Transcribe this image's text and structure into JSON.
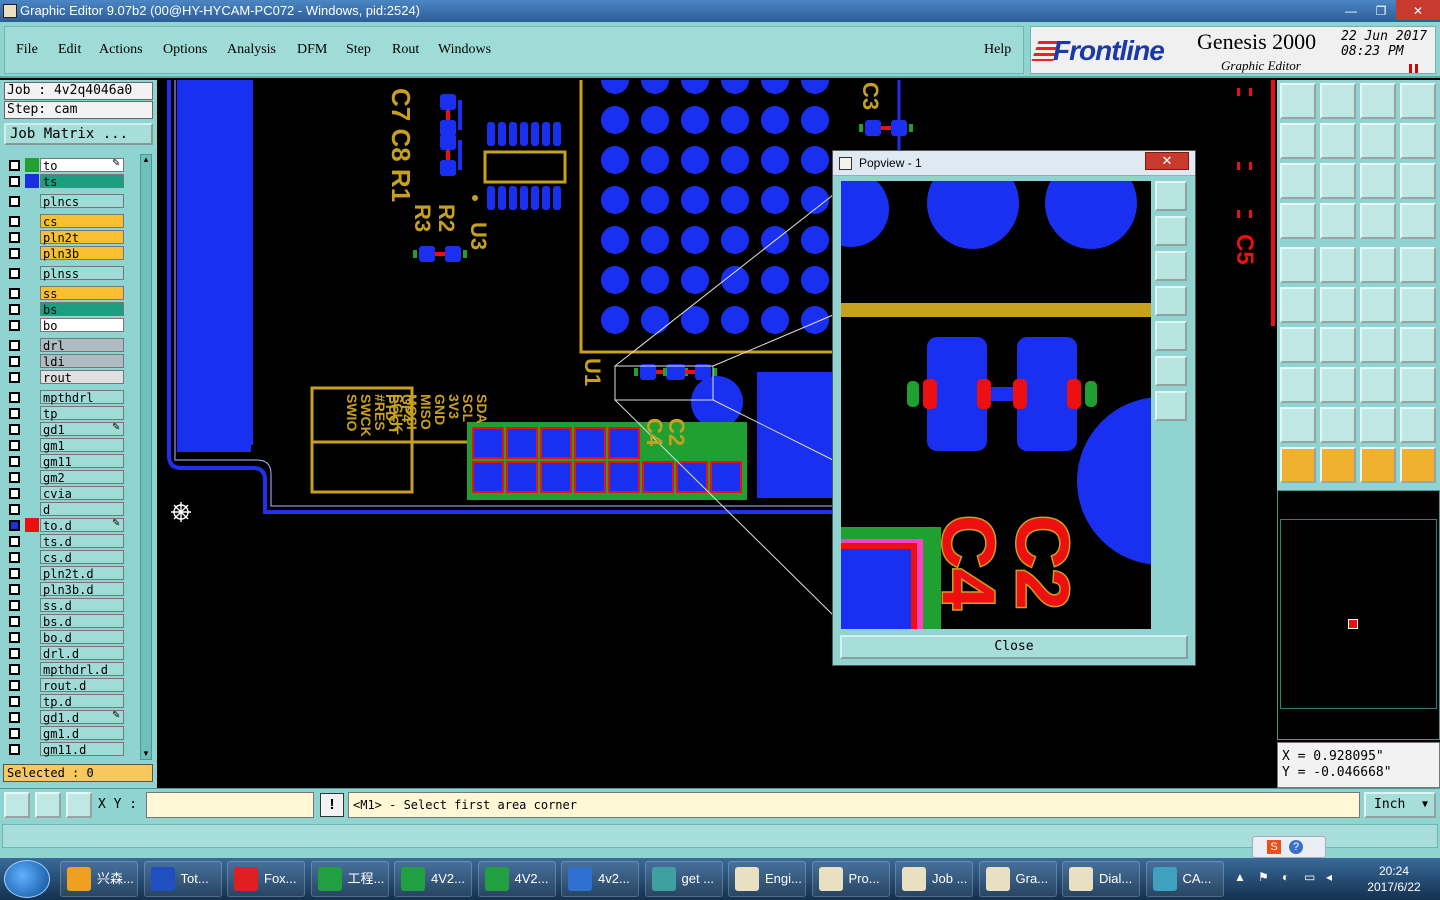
{
  "window": {
    "title": "Graphic Editor 9.07b2 (00@HY-HYCAM-PC072 - Windows, pid:2524)",
    "controls": [
      "—",
      "❐",
      "✕"
    ]
  },
  "menu": [
    "File",
    "Edit",
    "Actions",
    "Options",
    "Analysis",
    "DFM",
    "Step",
    "Rout",
    "Windows"
  ],
  "help_label": "Help",
  "brand": {
    "logo": "Frontline",
    "product": "Genesis 2000",
    "subtitle": "Graphic Editor",
    "date": "22  Jun  2017",
    "time": "08:23  PM"
  },
  "job": {
    "job_line": "Job : 4v2q4046a0",
    "step_line": "Step: cam",
    "matrix_button": "Job Matrix ..."
  },
  "layers": [
    {
      "name": "to",
      "color": "#ffffff",
      "swatch": "#22a030",
      "edge": true
    },
    {
      "name": "ts",
      "color": "#1aa080",
      "swatch": "#1a30e0"
    },
    {
      "name": "plncs",
      "color": "#9fdcd7",
      "swatch": ""
    },
    {
      "name": "cs",
      "color": "#f8c030",
      "swatch": ""
    },
    {
      "name": "pln2t",
      "color": "#f8c030",
      "swatch": ""
    },
    {
      "name": "pln3b",
      "color": "#f8c030",
      "swatch": ""
    },
    {
      "name": "plnss",
      "color": "#9fdcd7",
      "swatch": ""
    },
    {
      "name": "ss",
      "color": "#f8c030",
      "swatch": ""
    },
    {
      "name": "bs",
      "color": "#1aa080",
      "swatch": ""
    },
    {
      "name": "bo",
      "color": "#ffffff",
      "swatch": ""
    },
    {
      "name": "drl",
      "color": "#b0bcc4",
      "swatch": ""
    },
    {
      "name": "ldi",
      "color": "#b0bcc4",
      "swatch": ""
    },
    {
      "name": "rout",
      "color": "#e0e0e0",
      "swatch": ""
    },
    {
      "name": "mpthdrl",
      "color": "#9fdcd7",
      "swatch": ""
    },
    {
      "name": "tp",
      "color": "#9fdcd7",
      "swatch": ""
    },
    {
      "name": "gd1",
      "color": "#9fdcd7",
      "swatch": "",
      "edge": true
    },
    {
      "name": "gm1",
      "color": "#9fdcd7",
      "swatch": ""
    },
    {
      "name": "gm11",
      "color": "#9fdcd7",
      "swatch": ""
    },
    {
      "name": "gm2",
      "color": "#9fdcd7",
      "swatch": ""
    },
    {
      "name": "cvia",
      "color": "#9fdcd7",
      "swatch": ""
    },
    {
      "name": "d",
      "color": "#9fdcd7",
      "swatch": ""
    },
    {
      "name": "to.d",
      "color": "#9fdcd7",
      "swatch": "#ee1010",
      "edge": true,
      "active": true
    },
    {
      "name": "ts.d",
      "color": "#9fdcd7",
      "swatch": ""
    },
    {
      "name": "cs.d",
      "color": "#9fdcd7",
      "swatch": ""
    },
    {
      "name": "pln2t.d",
      "color": "#9fdcd7",
      "swatch": ""
    },
    {
      "name": "pln3b.d",
      "color": "#9fdcd7",
      "swatch": ""
    },
    {
      "name": "ss.d",
      "color": "#9fdcd7",
      "swatch": ""
    },
    {
      "name": "bs.d",
      "color": "#9fdcd7",
      "swatch": ""
    },
    {
      "name": "bo.d",
      "color": "#9fdcd7",
      "swatch": ""
    },
    {
      "name": "drl.d",
      "color": "#9fdcd7",
      "swatch": ""
    },
    {
      "name": "mpthdrl.d",
      "color": "#9fdcd7",
      "swatch": ""
    },
    {
      "name": "rout.d",
      "color": "#9fdcd7",
      "swatch": ""
    },
    {
      "name": "tp.d",
      "color": "#9fdcd7",
      "swatch": ""
    },
    {
      "name": "gd1.d",
      "color": "#9fdcd7",
      "swatch": "",
      "edge": true
    },
    {
      "name": "gm1.d",
      "color": "#9fdcd7",
      "swatch": ""
    },
    {
      "name": "gm11.d",
      "color": "#9fdcd7",
      "swatch": ""
    }
  ],
  "selected_label": "Selected : 0",
  "canvas": {
    "refdes": [
      "C7 C8 R1",
      "R2",
      "R3",
      "U3",
      "U1",
      "C2",
      "C4",
      "C3",
      "C5"
    ],
    "header_labels": [
      "GP4",
      "FTD",
      "BOOT",
      "#RES",
      "SWCK",
      "SWIO",
      "SDA",
      "SCL",
      "3V3",
      "GND",
      "MISO",
      "MOSI",
      "SCLK"
    ]
  },
  "popview": {
    "title": "Popview - 1",
    "close_label": "Close",
    "zoom_labels": [
      "C2",
      "C4"
    ]
  },
  "coords": {
    "x": "X = 0.928095\"",
    "y": "Y = -0.046668\""
  },
  "command": {
    "xy_label": "X Y :",
    "xy_value": "",
    "prompt": "<M1> - Select first area corner",
    "units": "Inch",
    "excl": "!"
  },
  "taskbar": {
    "items": [
      "兴森...",
      "Tot...",
      "Fox...",
      "工程...",
      "4V2...",
      "4V2...",
      "4v2...",
      "get ...",
      "Engi...",
      "Pro...",
      "Job ...",
      "Gra...",
      "Dial...",
      "CA..."
    ],
    "clock_time": "20:24",
    "clock_date": "2017/6/22"
  },
  "colors": {
    "pad": "#1a30f0",
    "silk": "#c8a020",
    "mask_green": "#20a030",
    "red": "#ee1010",
    "panel": "#8fd4d0"
  }
}
